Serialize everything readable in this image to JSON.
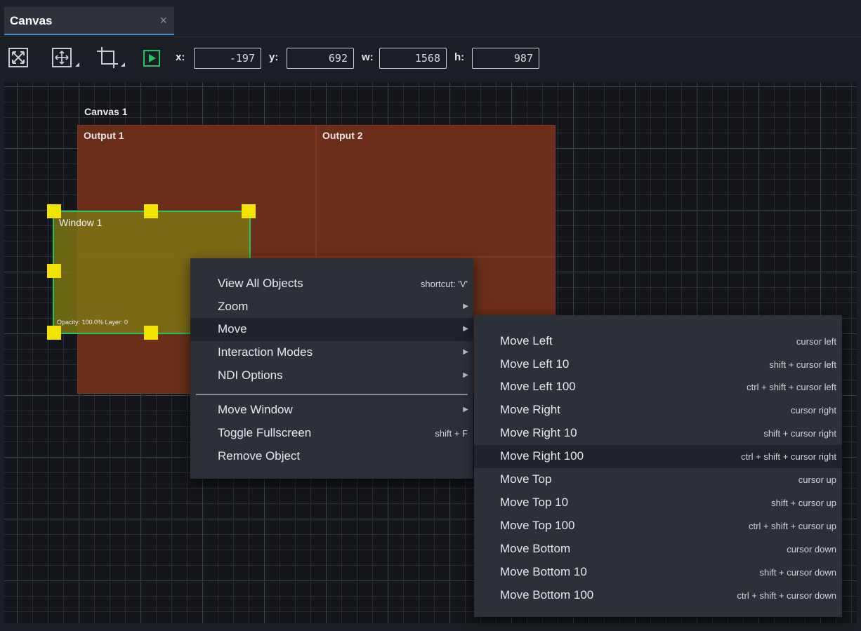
{
  "tab": {
    "title": "Canvas",
    "close_glyph": "×"
  },
  "toolbar": {
    "tools": [
      {
        "name": "fit-view-icon"
      },
      {
        "name": "move-tool-icon"
      },
      {
        "name": "crop-tool-icon"
      },
      {
        "name": "play-icon"
      }
    ],
    "x_label": "x:",
    "x_value": "-197",
    "y_label": "y:",
    "y_value": "692",
    "w_label": "w:",
    "w_value": "1568",
    "h_label": "h:",
    "h_value": "987",
    "accent_color": "#22c55e"
  },
  "canvas": {
    "canvas_label": "Canvas 1",
    "outputs": [
      "Output 1",
      "Output 2"
    ],
    "window": {
      "title": "Window 1",
      "meta": "Opacity: 100.0% Layer: 0",
      "fill_color": "#807614",
      "border_color": "#22c55e",
      "handle_color": "#f2e400"
    },
    "output_color": "#6b2e1a"
  },
  "context_menu": {
    "items": [
      {
        "label": "View All Objects",
        "shortcut": "shortcut: 'V'"
      },
      {
        "label": "Zoom",
        "submenu": true
      },
      {
        "label": "Move",
        "submenu": true,
        "active": true
      },
      {
        "label": "Interaction Modes",
        "submenu": true
      },
      {
        "label": "NDI Options",
        "submenu": true
      },
      {
        "label": "Move Window",
        "submenu": true
      },
      {
        "label": "Toggle Fullscreen",
        "shortcut": "shift + F"
      },
      {
        "label": "Remove Object"
      }
    ]
  },
  "move_submenu": {
    "items": [
      {
        "label": "Move Left",
        "shortcut": "cursor left"
      },
      {
        "label": "Move Left 10",
        "shortcut": "shift + cursor left"
      },
      {
        "label": "Move Left 100",
        "shortcut": "ctrl + shift + cursor left"
      },
      {
        "label": "Move Right",
        "shortcut": "cursor right"
      },
      {
        "label": "Move Right 10",
        "shortcut": "shift + cursor right"
      },
      {
        "label": "Move Right 100",
        "shortcut": "ctrl + shift + cursor right",
        "highlighted": true
      },
      {
        "label": "Move Top",
        "shortcut": "cursor up"
      },
      {
        "label": "Move Top 10",
        "shortcut": "shift + cursor up"
      },
      {
        "label": "Move Top 100",
        "shortcut": "ctrl + shift + cursor up"
      },
      {
        "label": "Move Bottom",
        "shortcut": "cursor down"
      },
      {
        "label": "Move Bottom 10",
        "shortcut": "shift + cursor down"
      },
      {
        "label": "Move Bottom 100",
        "shortcut": "ctrl + shift + cursor down"
      }
    ]
  }
}
